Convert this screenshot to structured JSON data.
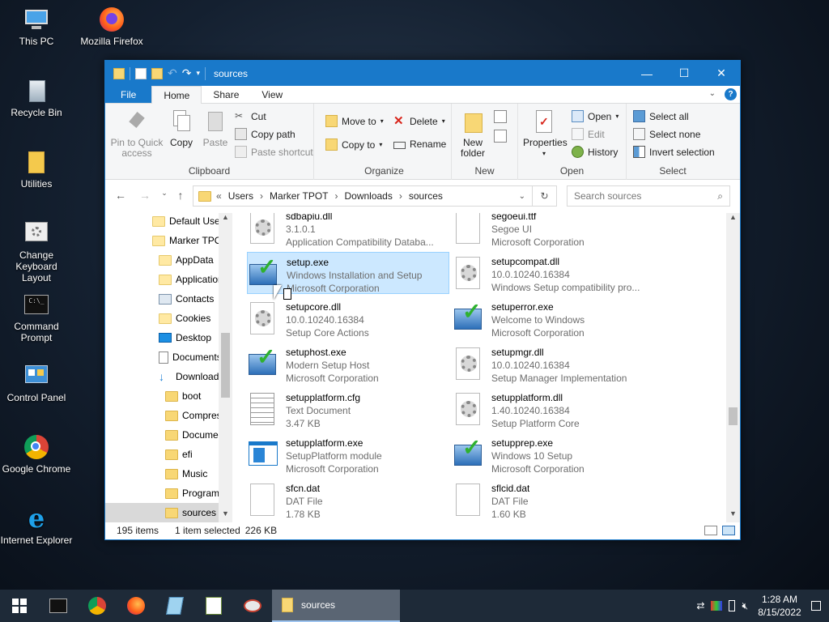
{
  "desktop": {
    "icons": [
      "This PC",
      "Mozilla Firefox",
      "Recycle Bin",
      "Utilities",
      "Change Keyboard Layout",
      "Command Prompt",
      "Control Panel",
      "Google Chrome",
      "Internet Explorer"
    ]
  },
  "window": {
    "title": "sources",
    "tabs": [
      "File",
      "Home",
      "Share",
      "View"
    ],
    "active_tab": "Home",
    "accent": "#1979ca"
  },
  "ribbon": {
    "clipboard": {
      "pin": "Pin to Quick access",
      "copy": "Copy",
      "paste": "Paste",
      "cut": "Cut",
      "copy_path": "Copy path",
      "paste_shortcut": "Paste shortcut",
      "label": "Clipboard"
    },
    "organize": {
      "move_to": "Move to",
      "copy_to": "Copy to",
      "delete": "Delete",
      "rename": "Rename",
      "label": "Organize"
    },
    "new": {
      "new_folder": "New folder",
      "label": "New"
    },
    "open": {
      "properties": "Properties",
      "open": "Open",
      "edit": "Edit",
      "history": "History",
      "label": "Open"
    },
    "select": {
      "select_all": "Select all",
      "select_none": "Select none",
      "invert": "Invert selection",
      "label": "Select"
    }
  },
  "address": {
    "crumbs": [
      "Users",
      "Marker TPOT",
      "Downloads",
      "sources"
    ],
    "search_placeholder": "Search sources"
  },
  "nav_items": [
    "Default User",
    "Marker TPOT",
    "AppData",
    "Application",
    "Contacts",
    "Cookies",
    "Desktop",
    "Documents",
    "Downloads",
    "boot",
    "Compressed",
    "Documents",
    "efi",
    "Music",
    "Programs",
    "sources"
  ],
  "files": [
    {
      "name": "sdbapiu.dll",
      "l1": "3.1.0.1",
      "l2": "Application Compatibility Databa...",
      "icon": "gear"
    },
    {
      "name": "segoeui.ttf",
      "l1": "Segoe UI",
      "l2": "Microsoft Corporation",
      "icon": "blank"
    },
    {
      "name": "setup.exe",
      "l1": "Windows Installation and Setup",
      "l2": "Microsoft Corporation",
      "icon": "setup"
    },
    {
      "name": "setupcompat.dll",
      "l1": "10.0.10240.16384",
      "l2": "Windows Setup compatibility pro...",
      "icon": "gear"
    },
    {
      "name": "setupcore.dll",
      "l1": "10.0.10240.16384",
      "l2": "Setup Core Actions",
      "icon": "gear"
    },
    {
      "name": "setuperror.exe",
      "l1": "Welcome to Windows",
      "l2": "Microsoft Corporation",
      "icon": "setup"
    },
    {
      "name": "setuphost.exe",
      "l1": "Modern Setup Host",
      "l2": "Microsoft Corporation",
      "icon": "setup"
    },
    {
      "name": "setupmgr.dll",
      "l1": "10.0.10240.16384",
      "l2": "Setup Manager Implementation",
      "icon": "gear"
    },
    {
      "name": "setupplatform.cfg",
      "l1": "Text Document",
      "l2": "3.47 KB",
      "icon": "text"
    },
    {
      "name": "setupplatform.dll",
      "l1": "1.40.10240.16384",
      "l2": "Setup Platform Core",
      "icon": "gear"
    },
    {
      "name": "setupplatform.exe",
      "l1": "SetupPlatform module",
      "l2": "Microsoft Corporation",
      "icon": "window"
    },
    {
      "name": "setupprep.exe",
      "l1": "Windows 10 Setup",
      "l2": "Microsoft Corporation",
      "icon": "setup"
    },
    {
      "name": "sfcn.dat",
      "l1": "DAT File",
      "l2": "1.78 KB",
      "icon": "blank"
    },
    {
      "name": "sflcid.dat",
      "l1": "DAT File",
      "l2": "1.60 KB",
      "icon": "blank"
    }
  ],
  "status": {
    "count": "195 items",
    "selected": "1 item selected",
    "size": "226 KB"
  },
  "taskbar": {
    "active_label": "sources",
    "time": "1:28 AM",
    "date": "8/15/2022"
  }
}
